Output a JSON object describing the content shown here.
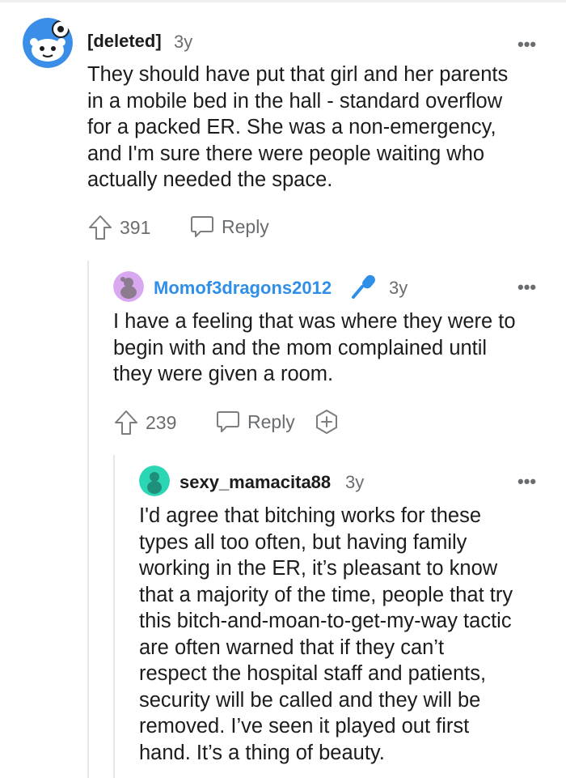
{
  "comments": [
    {
      "username": "[deleted]",
      "age": "3y",
      "body": "They should have put that girl and her parents\nin a mobile bed in the hall - standard overflow\nfor a packed ER. She was a non-emergency,\nand I'm sure there were people waiting who\nactually needed the space.",
      "votes": "391",
      "reply_label": "Reply",
      "more_label": "•••"
    },
    {
      "username": "Momof3dragons2012",
      "age": "3y",
      "body": "I have a feeling that was where they were to\nbegin with and the mom complained until\nthey were given a room.",
      "votes": "239",
      "reply_label": "Reply",
      "more_label": "•••"
    },
    {
      "username": "sexy_mamacita88",
      "age": "3y",
      "body": "I'd agree that bitching works for these\ntypes all too often, but having family\nworking in the ER, it’s pleasant to know\nthat a majority of the time, people that try\nthis bitch-and-moan-to-get-my-way tactic\nare often warned that if they can’t\nrespect the hospital staff and patients,\nsecurity will be called and they will be\nremoved. I’ve seen it played out first\nhand. It’s a thing of beauty.",
      "more_label": "•••"
    }
  ],
  "colors": {
    "blue_username": "#2f8fe8",
    "avatar_deleted": "#3a8ee8",
    "avatar_purple": "#d9a8f0",
    "avatar_teal": "#2bd6b4",
    "thread_line": "#e4e6e8"
  },
  "icons": [
    "upvote-icon",
    "reply-icon",
    "more-icon",
    "microphone-icon",
    "award-plus-icon"
  ]
}
